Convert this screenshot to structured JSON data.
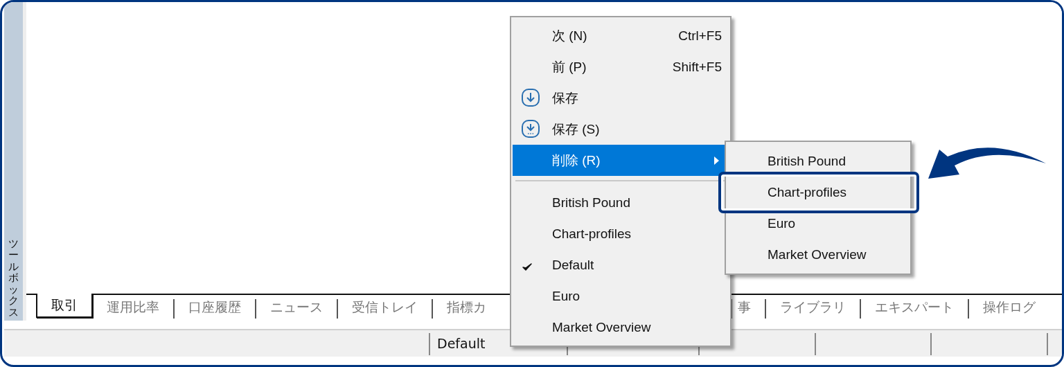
{
  "toolbox": {
    "label": "ツールボックス"
  },
  "tabs": [
    {
      "label": "取引",
      "selected": true
    },
    {
      "label": "運用比率",
      "selected": false
    },
    {
      "label": "口座履歴",
      "selected": false
    },
    {
      "label": "ニュース",
      "selected": false
    },
    {
      "label": "受信トレイ",
      "selected": false
    },
    {
      "label": "指標カ",
      "selected": false
    },
    {
      "label": "事",
      "selected": false
    },
    {
      "label": "ライブラリ",
      "selected": false
    },
    {
      "label": "エキスパート",
      "selected": false
    },
    {
      "label": "操作ログ",
      "selected": false
    }
  ],
  "status_bar": {
    "profile": "Default"
  },
  "menu": {
    "items": [
      {
        "kind": "command",
        "label": "次 (N)",
        "shortcut": "Ctrl+F5"
      },
      {
        "kind": "command",
        "label": "前 (P)",
        "shortcut": "Shift+F5"
      },
      {
        "kind": "save",
        "label": "保存"
      },
      {
        "kind": "save-as",
        "label": "保存 (S)"
      },
      {
        "kind": "submenu",
        "label": "削除 (R)",
        "selected": true
      },
      {
        "kind": "separator"
      },
      {
        "kind": "profile",
        "label": "British Pound",
        "checked": false
      },
      {
        "kind": "profile",
        "label": "Chart-profiles",
        "checked": false
      },
      {
        "kind": "profile",
        "label": "Default",
        "checked": true
      },
      {
        "kind": "profile",
        "label": "Euro",
        "checked": false
      },
      {
        "kind": "profile",
        "label": "Market Overview",
        "checked": false
      }
    ]
  },
  "submenu": {
    "items": [
      {
        "label": "British Pound",
        "callout": false
      },
      {
        "label": "Chart-profiles",
        "callout": true
      },
      {
        "label": "Euro",
        "callout": false
      },
      {
        "label": "Market Overview",
        "callout": false
      }
    ]
  }
}
